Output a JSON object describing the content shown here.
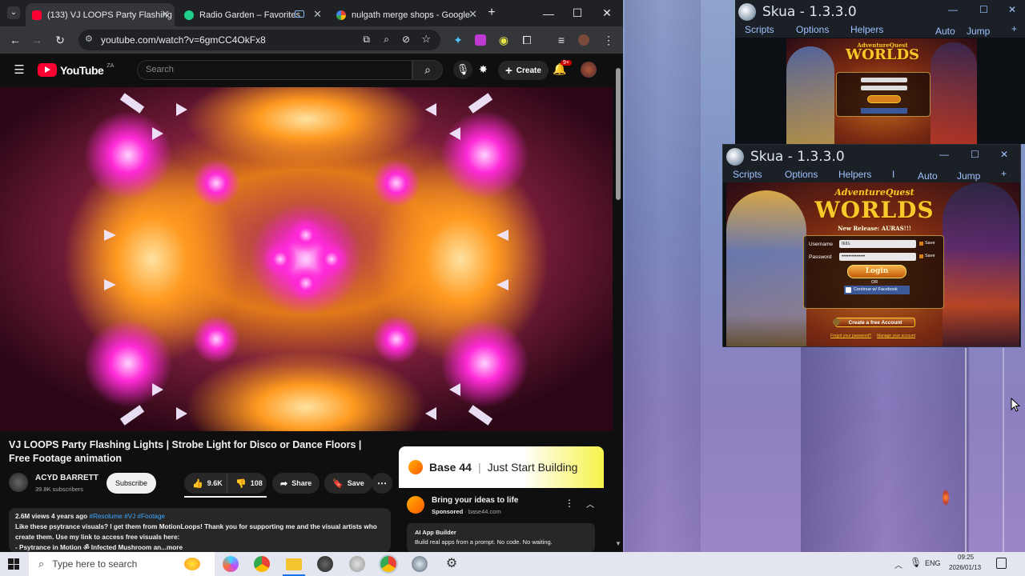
{
  "browser": {
    "tabs": [
      {
        "title": "(133) VJ LOOPS Party Flashing L",
        "active": true
      },
      {
        "title": "Radio Garden – Favorites",
        "active": false
      },
      {
        "title": "nulgath merge shops - Google",
        "active": false
      }
    ],
    "url": "youtube.com/watch?v=6gmCC4OkFx8"
  },
  "youtube": {
    "logo": "YouTube",
    "country": "ZA",
    "search_placeholder": "Search",
    "create_label": "Create",
    "notif_count": "9+",
    "video_title": "VJ LOOPS Party Flashing Lights | Strobe Light for Disco or Dance Floors | Free Footage animation",
    "channel": "ACYD BARRETT",
    "subscribers": "39.8K subscribers",
    "subscribe_label": "Subscribe",
    "likes": "9.6K",
    "dislikes": "108",
    "share_label": "Share",
    "save_label": "Save",
    "views_line": "2.6M views  4 years ago",
    "hashtags": "#Resolume #VJ #Footage",
    "desc_line1": "Like these psytrance visuals? I get them from MotionLoops! Thank you for supporting me and the visual artists who",
    "desc_line2": "create them. Use my link to access free visuals here:",
    "desc_line3": "- Psytrance in Motion ॐ Infected Mushroom an",
    "desc_more": "...more",
    "ad": {
      "brand": "Base 44",
      "tagline": "Just Start Building",
      "headline": "Bring your ideas to life",
      "sponsored": "Sponsored",
      "domain": "base44.com",
      "card_title": "AI App Builder",
      "card_text": "Build real apps from a prompt. No code. No waiting."
    }
  },
  "skua_windows": [
    {
      "title": "Skua - 1.3.3.0",
      "menu": [
        "Scripts",
        "Options",
        "Helpers"
      ],
      "right_menu": [
        "Auto",
        "Jump",
        "+"
      ]
    },
    {
      "title": "Skua - 1.3.3.0",
      "menu": [
        "Scripts",
        "Options",
        "Helpers",
        "I"
      ],
      "right_menu": [
        "Auto",
        "Jump",
        "+"
      ],
      "game": {
        "logo_top": "AdventureQuest",
        "logo_main": "WORLDS",
        "release": "New Release: AURAS!!!",
        "username_label": "Username",
        "username_value": "tkits",
        "password_label": "Password",
        "password_value": "••••••••••••••",
        "save_label": "Save",
        "login_label": "Login",
        "or_label": "OR",
        "facebook_label": "Continue w/ Facebook",
        "create_label": "Create a free Account",
        "forgot_label": "Forgot your password?",
        "manage_label": "Manage your account"
      }
    }
  ],
  "taskbar": {
    "search_placeholder": "Type here to search",
    "language": "ENG",
    "time": "09:25",
    "date": "2026/01/13"
  }
}
